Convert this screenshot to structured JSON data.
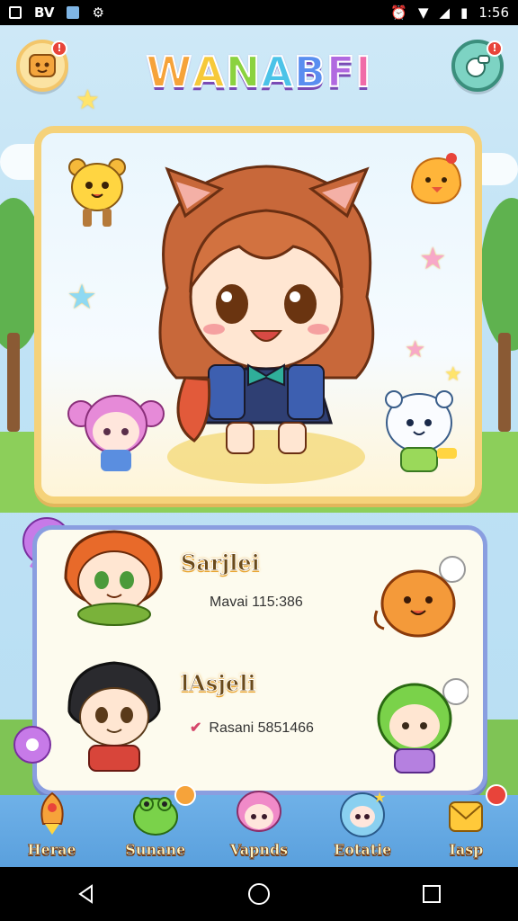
{
  "status_bar": {
    "left_icons": [
      "image-icon",
      "bv-icon",
      "image-icon",
      "settings-icon"
    ],
    "bv_label": "BV",
    "time": "1:56"
  },
  "header": {
    "logo_letters": [
      "W",
      "A",
      "N",
      "A",
      "B",
      "F",
      "I"
    ],
    "left_button_icon": "profile-card-icon",
    "right_button_icon": "whistle-icon",
    "notification_mark": "!"
  },
  "stage": {
    "main_character_icon": "cat-ear-girl-avatar",
    "companions": [
      "yellow-bear",
      "chick",
      "pink-hair-girl",
      "white-bunny"
    ]
  },
  "friends": [
    {
      "name": "Sarjlei",
      "detail": "Mavai 115:386",
      "avatar_icon": "orange-hair-boy",
      "pet_icon": "orange-cat"
    },
    {
      "name": "lAsjeli",
      "detail": "Rasani 5851466",
      "check": "✔",
      "avatar_icon": "black-hair-boy",
      "pet_icon": "green-hair-girl"
    }
  ],
  "bottom_nav": [
    {
      "label": "Herae",
      "icon": "rocket-icon"
    },
    {
      "label": "Sunane",
      "icon": "frog-icon"
    },
    {
      "label": "Vapnds",
      "icon": "girl-icon"
    },
    {
      "label": "Eotatie",
      "icon": "globe-icon"
    },
    {
      "label": "Iasp",
      "icon": "mail-icon"
    }
  ],
  "colors": {
    "stage_border": "#f5d27a",
    "panel_border": "#8a9ee0",
    "nav_bg": "#5aa0dd",
    "badge": "#e8443a"
  }
}
